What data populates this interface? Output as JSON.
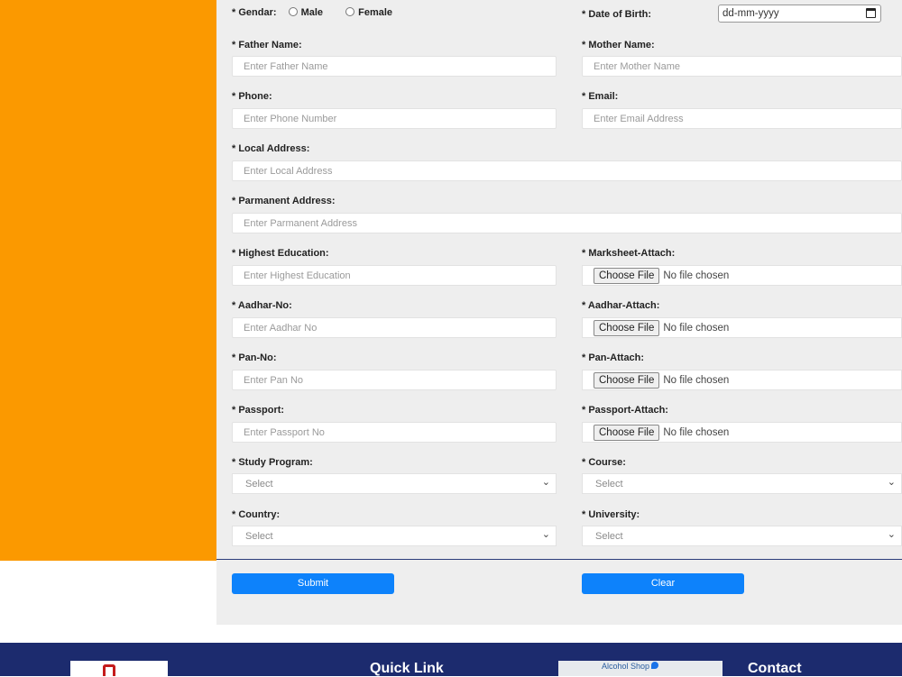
{
  "gender": {
    "label": "* Gendar:",
    "options": [
      "Male",
      "Female"
    ]
  },
  "dob": {
    "label": "* Date of Birth:",
    "value": "dd-mm-yyyy"
  },
  "father": {
    "label": "* Father Name:",
    "placeholder": "Enter Father Name"
  },
  "mother": {
    "label": "* Mother Name:",
    "placeholder": "Enter Mother Name"
  },
  "phone": {
    "label": "* Phone:",
    "placeholder": "Enter Phone Number"
  },
  "email": {
    "label": "* Email:",
    "placeholder": "Enter Email Address"
  },
  "local_address": {
    "label": "* Local Address:",
    "placeholder": "Enter Local Address"
  },
  "permanent_address": {
    "label": "* Parmanent Address:",
    "placeholder": "Enter Parmanent Address"
  },
  "education": {
    "label": "* Highest Education:",
    "placeholder": "Enter Highest Education"
  },
  "marksheet": {
    "label": "* Marksheet-Attach:"
  },
  "aadhar": {
    "label": "* Aadhar-No:",
    "placeholder": "Enter Aadhar No"
  },
  "aadhar_attach": {
    "label": "* Aadhar-Attach:"
  },
  "pan": {
    "label": "* Pan-No:",
    "placeholder": "Enter Pan No"
  },
  "pan_attach": {
    "label": "* Pan-Attach:"
  },
  "passport": {
    "label": "* Passport:",
    "placeholder": "Enter Passport No"
  },
  "passport_attach": {
    "label": "* Passport-Attach:"
  },
  "file": {
    "button": "Choose File",
    "status": "No file chosen"
  },
  "study_program": {
    "label": "* Study Program:",
    "value": "Select"
  },
  "course": {
    "label": "* Course:",
    "value": "Select"
  },
  "country": {
    "label": "* Country:",
    "value": "Select"
  },
  "university": {
    "label": "* University:",
    "value": "Select"
  },
  "buttons": {
    "submit": "Submit",
    "clear": "Clear"
  },
  "footer": {
    "quick_link": "Quick Link",
    "contact": "Contact",
    "map_text": "Alcohol Shop"
  },
  "icons": {
    "chevron": "chevron-down-icon",
    "calendar": "calendar-icon",
    "map_pin": "map-pin-icon"
  },
  "colors": {
    "sidebar": "#fb9900",
    "button": "#0d82fb",
    "footer": "#1c2b6e"
  }
}
